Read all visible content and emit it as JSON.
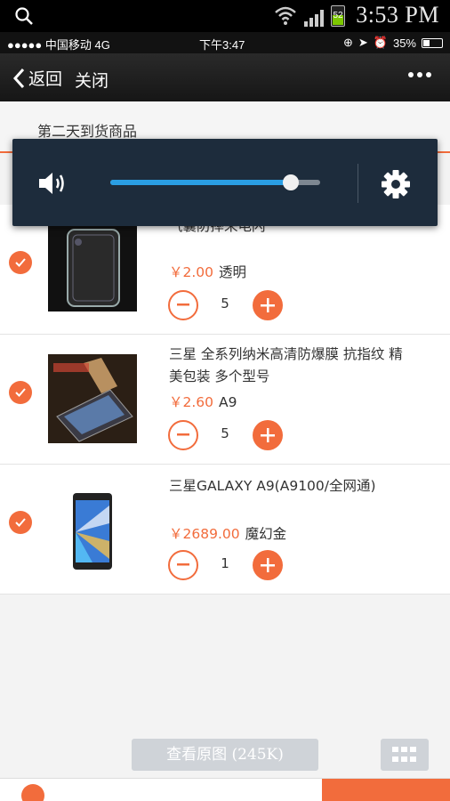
{
  "android_status": {
    "time": "3:53 PM",
    "battery_level": "52"
  },
  "ios_status": {
    "carrier": "●●●●● 中国移动  4G",
    "time": "下午3:47",
    "battery": "35%"
  },
  "navbar": {
    "back_label": "返回",
    "close_label": "关闭"
  },
  "section": {
    "title": "第二天到货商品"
  },
  "volume": {
    "level": 0.86
  },
  "items": [
    {
      "name_line1": "",
      "name_line2": "气囊防摔来电闪",
      "price": "￥2.00",
      "variant": "透明",
      "quantity": "5"
    },
    {
      "name_line1": "三星 全系列纳米高清防爆膜 抗指纹 精",
      "name_line2": "美包装 多个型号",
      "price": "￥2.60",
      "variant": "A9",
      "quantity": "5"
    },
    {
      "name_line1": "三星GALAXY A9(A9100/全网通)",
      "name_line2": "",
      "price": "￥2689.00",
      "variant": "魔幻金",
      "quantity": "1"
    }
  ],
  "viewer": {
    "view_original_label": "查看原图 (245K)"
  }
}
